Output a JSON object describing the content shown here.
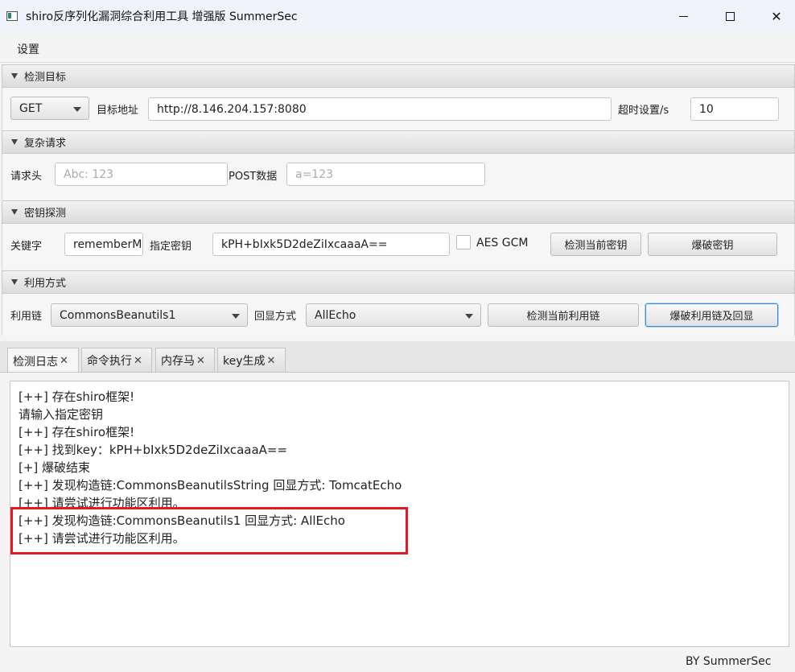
{
  "window": {
    "title": "shiro反序列化漏洞综合利用工具 增强版 SummerSec",
    "close_glyph": "✕"
  },
  "menu": {
    "settings": "设置"
  },
  "target": {
    "header": "检测目标",
    "method": "GET",
    "url_label": "目标地址",
    "url_value": "http://8.146.204.157:8080",
    "timeout_label": "超时设置/s",
    "timeout_value": "10"
  },
  "complex": {
    "header": "复杂请求",
    "headers_label": "请求头",
    "headers_placeholder": "Abc: 123",
    "post_label": "POST数据",
    "post_placeholder": "a=123"
  },
  "key": {
    "header": "密钥探测",
    "keyword_label": "关键字",
    "keyword_value": "rememberMe",
    "key_label": "指定密钥",
    "key_value": "kPH+bIxk5D2deZiIxcaaaA==",
    "aes_gcm_label": "AES GCM",
    "check_key_button": "检测当前密钥",
    "brute_key_button": "爆破密钥"
  },
  "exploit": {
    "header": "利用方式",
    "chain_label": "利用链",
    "chain_value": "CommonsBeanutils1",
    "echo_label": "回显方式",
    "echo_value": "AllEcho",
    "check_chain_button": "检测当前利用链",
    "brute_chain_button": "爆破利用链及回显"
  },
  "tabs": [
    {
      "label": "检测日志"
    },
    {
      "label": "命令执行"
    },
    {
      "label": "内存马"
    },
    {
      "label": "key生成"
    }
  ],
  "tab_close": "✕",
  "log": [
    "[++] 存在shiro框架!",
    "请输入指定密钥",
    "[++] 存在shiro框架!",
    "[++] 找到key：kPH+bIxk5D2deZiIxcaaaA==",
    "[+] 爆破结束",
    "[++] 发现构造链:CommonsBeanutilsString  回显方式: TomcatEcho",
    "[++] 请尝试进行功能区利用。",
    "[++] 发现构造链:CommonsBeanutils1  回显方式: AllEcho",
    "[++] 请尝试进行功能区利用。"
  ],
  "footer": "BY    SummerSec",
  "colors": {
    "highlight": "#e01b24",
    "focus": "#3c8fd6"
  }
}
